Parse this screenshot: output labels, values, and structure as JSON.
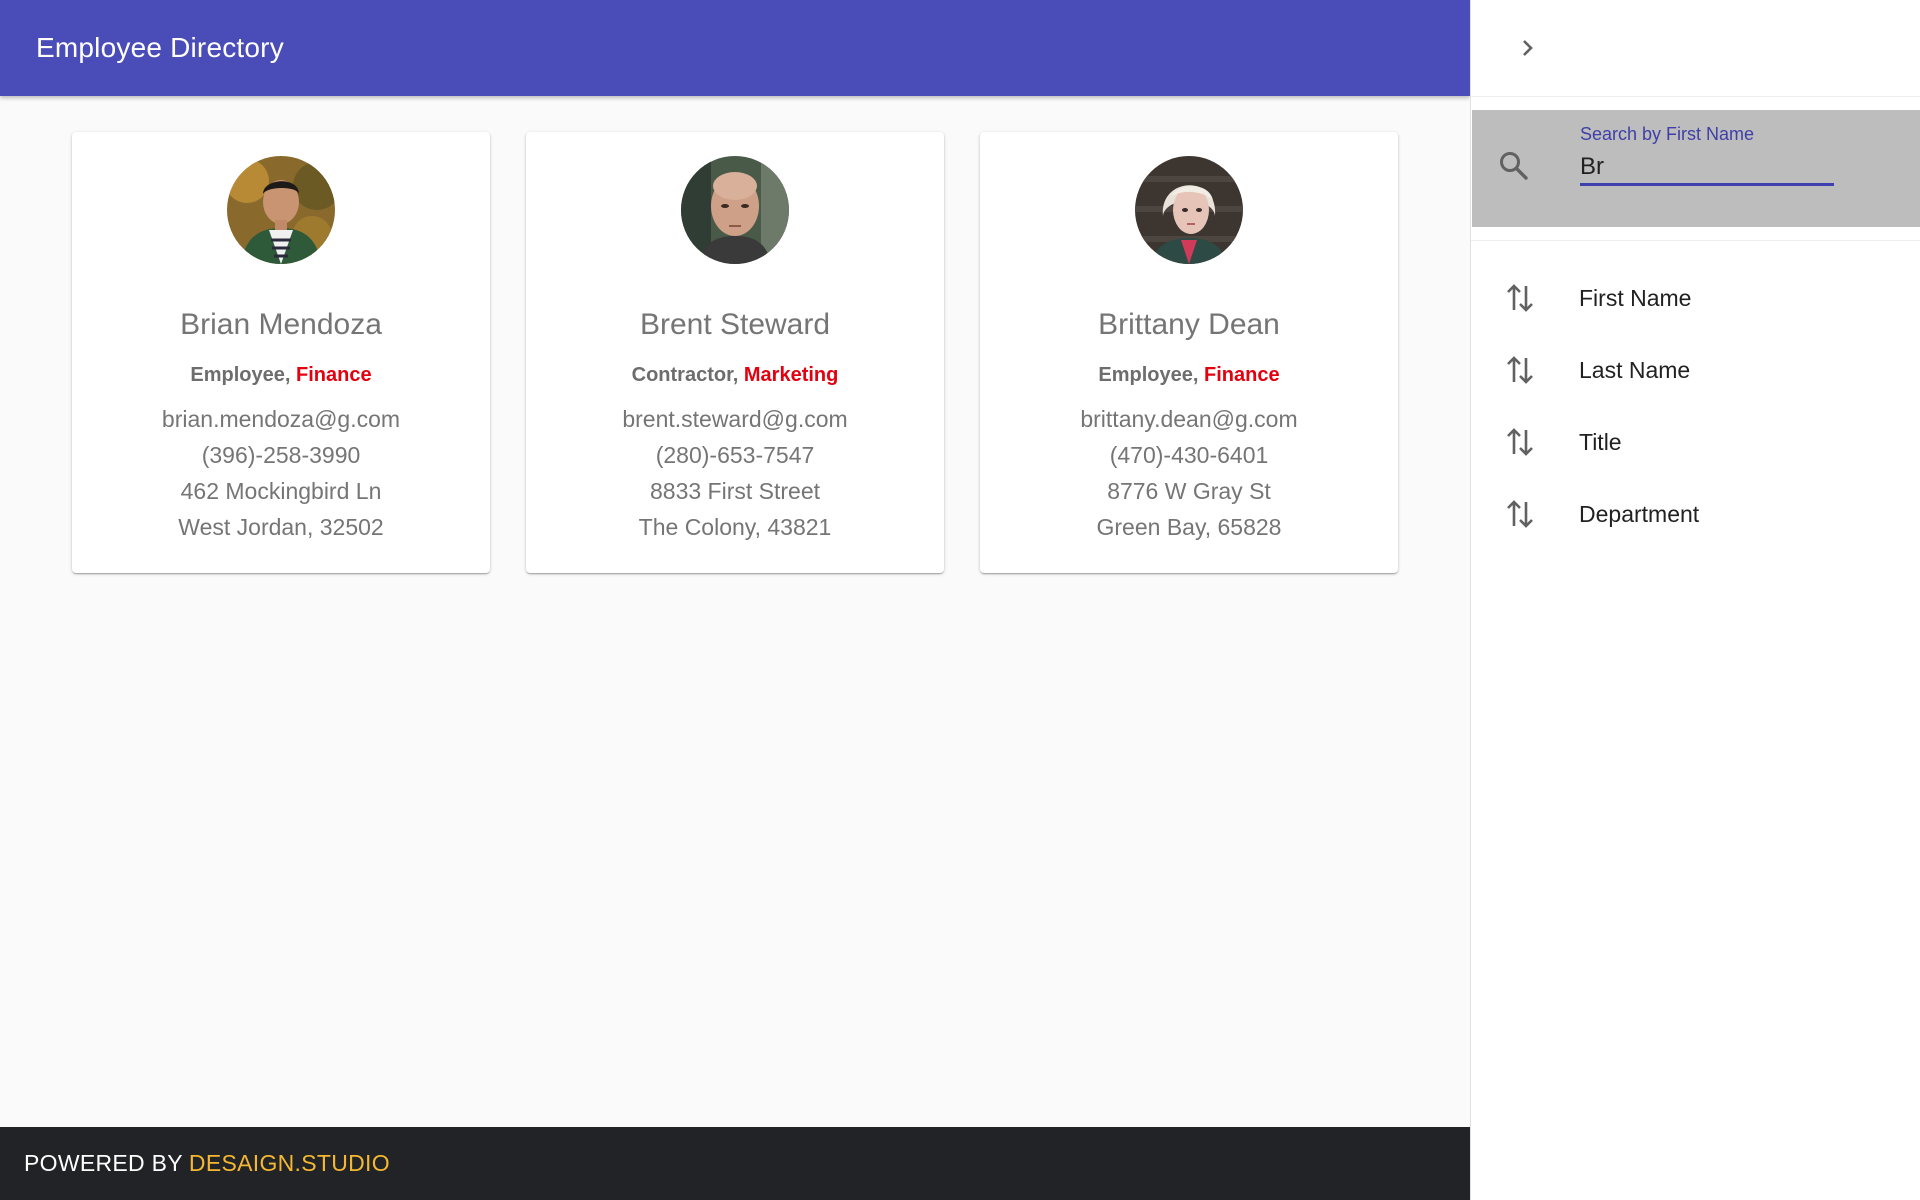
{
  "appbar": {
    "title": "Employee Directory"
  },
  "employees": [
    {
      "name": "Brian Mendoza",
      "role": "Employee",
      "department": "Finance",
      "email": "brian.mendoza@g.com",
      "phone": "(396)-258-3990",
      "street": "462 Mockingbird Ln",
      "city": "West Jordan, 32502"
    },
    {
      "name": "Brent Steward",
      "role": "Contractor",
      "department": "Marketing",
      "email": "brent.steward@g.com",
      "phone": "(280)-653-7547",
      "street": "8833 First Street",
      "city": "The Colony, 43821"
    },
    {
      "name": "Brittany Dean",
      "role": "Employee",
      "department": "Finance",
      "email": "brittany.dean@g.com",
      "phone": "(470)-430-6401",
      "street": "8776 W Gray St",
      "city": "Green Bay, 65828"
    }
  ],
  "footer": {
    "prefix": "POWERED BY",
    "brand": "DESAIGN.STUDIO"
  },
  "drawer": {
    "search": {
      "label": "Search by First Name",
      "value": "Br"
    },
    "sort_options": [
      {
        "label": "First Name"
      },
      {
        "label": "Last Name"
      },
      {
        "label": "Title"
      },
      {
        "label": "Department"
      }
    ]
  },
  "colors": {
    "appbar": "#4a4cb8",
    "department": "#e3000f",
    "footer_bg": "#212326",
    "footer_brand": "#f5b731",
    "search_accent": "#3f40b0"
  },
  "icons": {
    "drawer_toggle": "chevron-right-icon",
    "search": "search-icon",
    "sort": "sort-arrows-icon"
  }
}
